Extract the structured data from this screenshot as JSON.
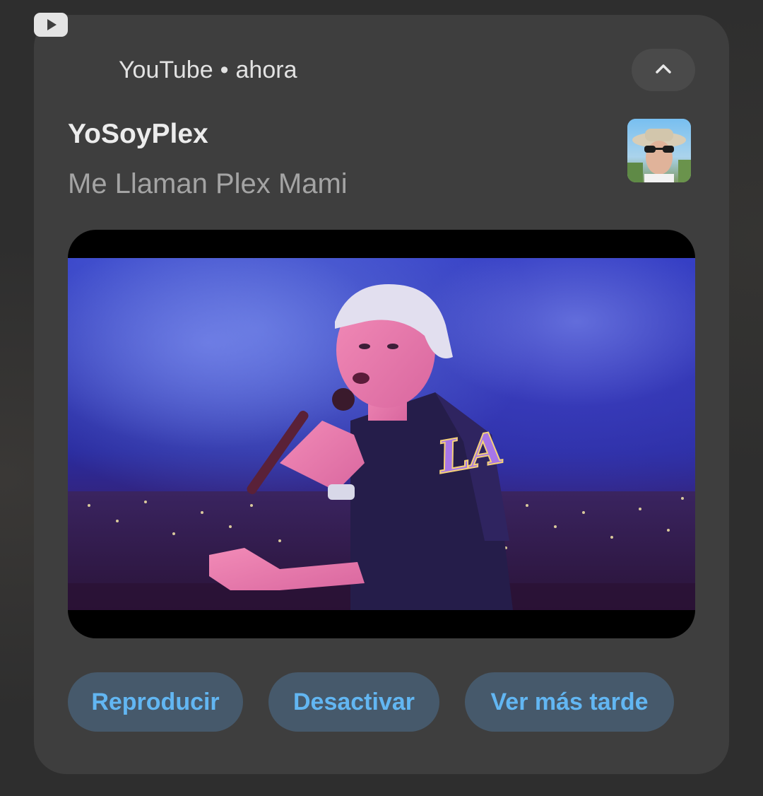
{
  "notification": {
    "app_name": "YouTube",
    "separator": "•",
    "time": "ahora",
    "title": "YoSoyPlex",
    "text": "Me Llaman Plex Mami",
    "collapse_icon": "chevron-up-icon",
    "app_icon": "youtube-icon"
  },
  "media": {
    "description": "video-thumbnail"
  },
  "actions": [
    {
      "label": "Reproducir"
    },
    {
      "label": "Desactivar"
    },
    {
      "label": "Ver más tarde"
    }
  ],
  "colors": {
    "card": "#3e3e3e",
    "action_bg": "#46596b",
    "action_text": "#62b6f2"
  }
}
